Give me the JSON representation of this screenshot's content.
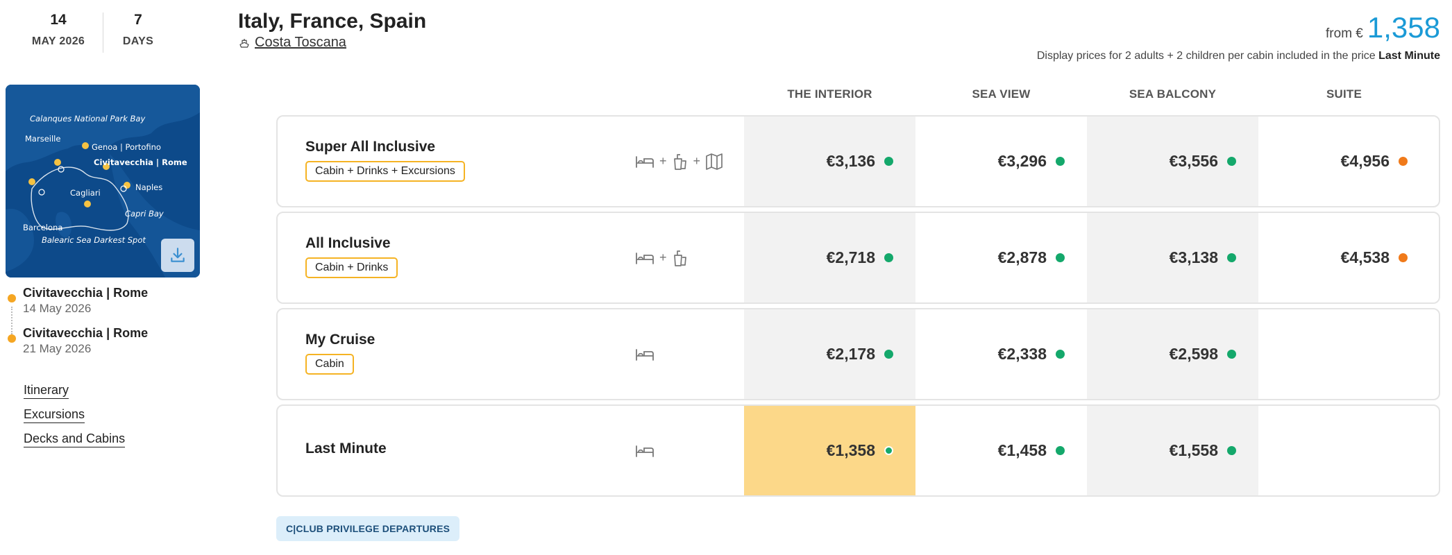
{
  "departure": {
    "day": "14",
    "month_year": "MAY 2026"
  },
  "duration": {
    "value": "7",
    "unit": "DAYS"
  },
  "cruise": {
    "title": "Italy, France, Spain",
    "ship": "Costa Toscana",
    "from_label": "from €",
    "from_price": "1,358",
    "price_note_prefix": "Display prices for 2 adults + 2 children per cabin included in the price",
    "price_note_bold": "Last Minute"
  },
  "map": {
    "labels": {
      "calanques": "Calanques National Park Bay",
      "marseille": "Marseille",
      "genoa": "Genoa | Portofino",
      "civitavecchia": "Civitavecchia | Rome",
      "naples": "Naples",
      "cagliari": "Cagliari",
      "capri": "Capri Bay",
      "barcelona": "Barcelona",
      "balearic": "Balearic Sea Darkest Spot"
    }
  },
  "route": [
    {
      "port": "Civitavecchia | Rome",
      "date": "14 May 2026"
    },
    {
      "port": "Civitavecchia | Rome",
      "date": "21 May 2026"
    }
  ],
  "side_links": [
    "Itinerary",
    "Excursions",
    "Decks and Cabins"
  ],
  "columns": [
    "THE INTERIOR",
    "SEA VIEW",
    "SEA BALCONY",
    "SUITE"
  ],
  "packages": [
    {
      "name": "Super All Inclusive",
      "tag": "Cabin + Drinks + Excursions",
      "prices": [
        {
          "value": "€3,136",
          "status": "green"
        },
        {
          "value": "€3,296",
          "status": "green"
        },
        {
          "value": "€3,556",
          "status": "green"
        },
        {
          "value": "€4,956",
          "status": "orange"
        }
      ]
    },
    {
      "name": "All Inclusive",
      "tag": "Cabin + Drinks",
      "prices": [
        {
          "value": "€2,718",
          "status": "green"
        },
        {
          "value": "€2,878",
          "status": "green"
        },
        {
          "value": "€3,138",
          "status": "green"
        },
        {
          "value": "€4,538",
          "status": "orange"
        }
      ]
    },
    {
      "name": "My Cruise",
      "tag": "Cabin",
      "prices": [
        {
          "value": "€2,178",
          "status": "green"
        },
        {
          "value": "€2,338",
          "status": "green"
        },
        {
          "value": "€2,598",
          "status": "green"
        }
      ]
    },
    {
      "name": "Last Minute",
      "prices": [
        {
          "value": "€1,358",
          "status": "green"
        },
        {
          "value": "€1,458",
          "status": "green"
        },
        {
          "value": "€1,558",
          "status": "green"
        }
      ]
    }
  ],
  "cclub_label": "C|CLUB PRIVILEGE DEPARTURES",
  "colors": {
    "accent_blue": "#1a9ad6",
    "tag_border": "#f5b323",
    "highlight": "#fcd889",
    "available": "#14a86b",
    "limited": "#f07a1a",
    "map_sea": "#0d4a8a",
    "route_dot": "#f5a623"
  },
  "icons": [
    "bed-icon",
    "drinks-icon",
    "map-icon",
    "ship-icon",
    "download-icon"
  ]
}
